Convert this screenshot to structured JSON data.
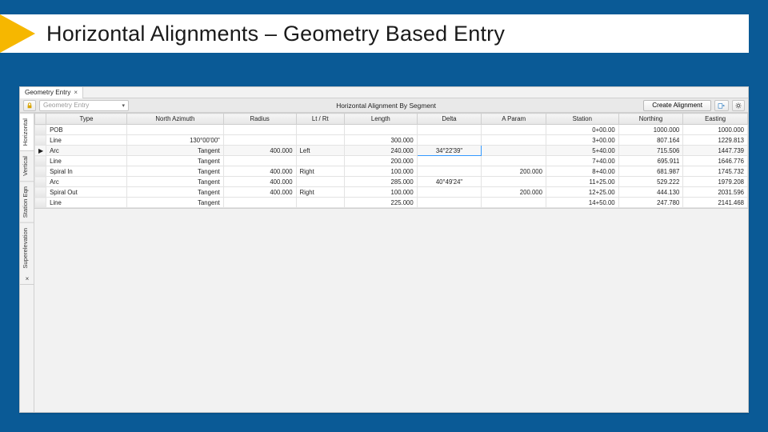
{
  "slide": {
    "title": "Horizontal Alignments – Geometry Based Entry"
  },
  "tab": {
    "label": "Geometry Entry",
    "close_glyph": "×"
  },
  "toolbar": {
    "combo_placeholder": "Geometry Entry",
    "title": "Horizontal Alignment By Segment",
    "create_label": "Create Alignment"
  },
  "rail": {
    "tabs": [
      "Horizontal",
      "Vertical",
      "Station Eqn",
      "Superelevation"
    ],
    "close_glyph": "×"
  },
  "grid": {
    "headers": [
      "Type",
      "North Azimuth",
      "Radius",
      "Lt / Rt",
      "Length",
      "Delta",
      "A Param",
      "Station",
      "Northing",
      "Easting"
    ],
    "rows": [
      {
        "marker": "",
        "type": "POB",
        "azm": "",
        "radius": "",
        "ltrt": "",
        "length": "",
        "delta": "",
        "aparam": "",
        "station": "0+00.00",
        "northing": "1000.000",
        "easting": "1000.000"
      },
      {
        "marker": "",
        "type": "Line",
        "azm": "130°00'00\"",
        "radius": "",
        "ltrt": "",
        "length": "300.000",
        "delta": "",
        "aparam": "",
        "station": "3+00.00",
        "northing": "807.164",
        "easting": "1229.813"
      },
      {
        "marker": "▶",
        "type": "Arc",
        "azm": "Tangent",
        "radius": "400.000",
        "ltrt": "Left",
        "length": "240.000",
        "delta": "34°22'39\"",
        "aparam": "",
        "station": "5+40.00",
        "northing": "715.506",
        "easting": "1447.739",
        "focus": "delta"
      },
      {
        "marker": "",
        "type": "Line",
        "azm": "Tangent",
        "radius": "",
        "ltrt": "",
        "length": "200.000",
        "delta": "",
        "aparam": "",
        "station": "7+40.00",
        "northing": "695.911",
        "easting": "1646.776"
      },
      {
        "marker": "",
        "type": "Spiral In",
        "azm": "Tangent",
        "radius": "400.000",
        "ltrt": "Right",
        "length": "100.000",
        "delta": "",
        "aparam": "200.000",
        "station": "8+40.00",
        "northing": "681.987",
        "easting": "1745.732"
      },
      {
        "marker": "",
        "type": "Arc",
        "azm": "Tangent",
        "radius": "400.000",
        "ltrt": "",
        "length": "285.000",
        "delta": "40°49'24\"",
        "aparam": "",
        "station": "11+25.00",
        "northing": "529.222",
        "easting": "1979.208"
      },
      {
        "marker": "",
        "type": "Spiral Out",
        "azm": "Tangent",
        "radius": "400.000",
        "ltrt": "Right",
        "length": "100.000",
        "delta": "",
        "aparam": "200.000",
        "station": "12+25.00",
        "northing": "444.130",
        "easting": "2031.596"
      },
      {
        "marker": "",
        "type": "Line",
        "azm": "Tangent",
        "radius": "",
        "ltrt": "",
        "length": "225.000",
        "delta": "",
        "aparam": "",
        "station": "14+50.00",
        "northing": "247.780",
        "easting": "2141.468"
      }
    ]
  }
}
